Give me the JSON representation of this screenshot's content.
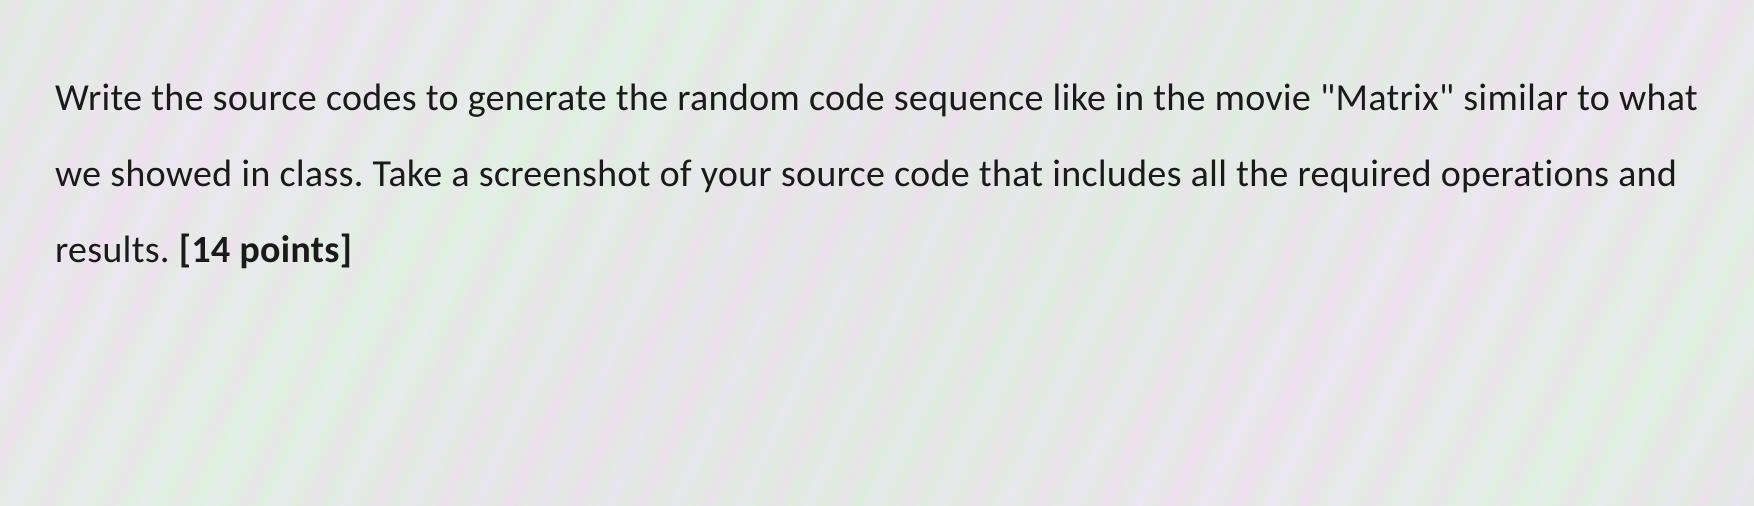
{
  "question": {
    "text_part1": "Write the source codes to generate the random code sequence like in the movie \"Matrix\" similar to what we showed in class. Take a screenshot of your source code that includes all the required operations and results. ",
    "points_label": "[14 points]"
  }
}
